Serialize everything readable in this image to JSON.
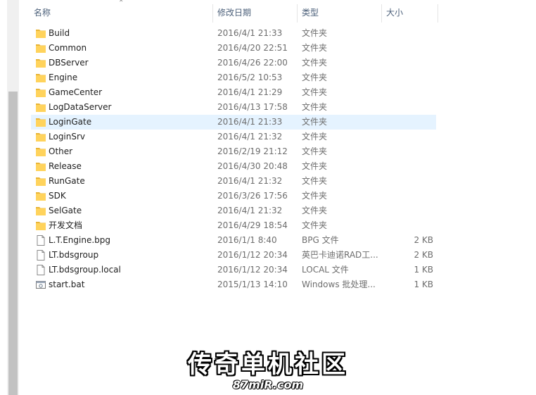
{
  "columns": {
    "name": "名称",
    "date": "修改日期",
    "type": "类型",
    "size": "大小"
  },
  "files": [
    {
      "name": "Build",
      "date": "2016/4/1 21:33",
      "type": "文件夹",
      "size": "",
      "icon": "folder-icon"
    },
    {
      "name": "Common",
      "date": "2016/4/20 22:51",
      "type": "文件夹",
      "size": "",
      "icon": "folder-icon"
    },
    {
      "name": "DBServer",
      "date": "2016/4/26 22:00",
      "type": "文件夹",
      "size": "",
      "icon": "folder-icon"
    },
    {
      "name": "Engine",
      "date": "2016/5/2 10:53",
      "type": "文件夹",
      "size": "",
      "icon": "folder-icon"
    },
    {
      "name": "GameCenter",
      "date": "2016/4/1 21:29",
      "type": "文件夹",
      "size": "",
      "icon": "folder-icon"
    },
    {
      "name": "LogDataServer",
      "date": "2016/4/13 17:58",
      "type": "文件夹",
      "size": "",
      "icon": "folder-icon"
    },
    {
      "name": "LoginGate",
      "date": "2016/4/1 21:33",
      "type": "文件夹",
      "size": "",
      "icon": "folder-icon"
    },
    {
      "name": "LoginSrv",
      "date": "2016/4/1 21:32",
      "type": "文件夹",
      "size": "",
      "icon": "folder-icon"
    },
    {
      "name": "Other",
      "date": "2016/2/19 21:12",
      "type": "文件夹",
      "size": "",
      "icon": "folder-icon"
    },
    {
      "name": "Release",
      "date": "2016/4/30 20:48",
      "type": "文件夹",
      "size": "",
      "icon": "folder-icon"
    },
    {
      "name": "RunGate",
      "date": "2016/4/1 21:32",
      "type": "文件夹",
      "size": "",
      "icon": "folder-icon"
    },
    {
      "name": "SDK",
      "date": "2016/3/26 17:56",
      "type": "文件夹",
      "size": "",
      "icon": "folder-icon"
    },
    {
      "name": "SelGate",
      "date": "2016/4/1 21:32",
      "type": "文件夹",
      "size": "",
      "icon": "folder-icon"
    },
    {
      "name": "开发文档",
      "date": "2016/4/29 18:54",
      "type": "文件夹",
      "size": "",
      "icon": "folder-icon"
    },
    {
      "name": "L.T.Engine.bpg",
      "date": "2016/1/1 8:40",
      "type": "BPG 文件",
      "size": "2 KB",
      "icon": "file-icon"
    },
    {
      "name": "LT.bdsgroup",
      "date": "2016/1/12 20:34",
      "type": "英巴卡迪诺RAD工...",
      "size": "2 KB",
      "icon": "file-icon"
    },
    {
      "name": "LT.bdsgroup.local",
      "date": "2016/1/12 20:34",
      "type": "LOCAL 文件",
      "size": "1 KB",
      "icon": "file-icon"
    },
    {
      "name": "start.bat",
      "date": "2015/1/13 14:10",
      "type": "Windows 批处理...",
      "size": "1 KB",
      "icon": "batch-file-icon"
    }
  ],
  "selected_index": 6,
  "watermark": {
    "title": "传奇单机社区",
    "subtitle": "87miR.com"
  },
  "colors": {
    "folder": "#ffd35c",
    "folder_dark": "#e8b437",
    "selection": "#e5f3ff",
    "header_text": "#4c607a"
  }
}
